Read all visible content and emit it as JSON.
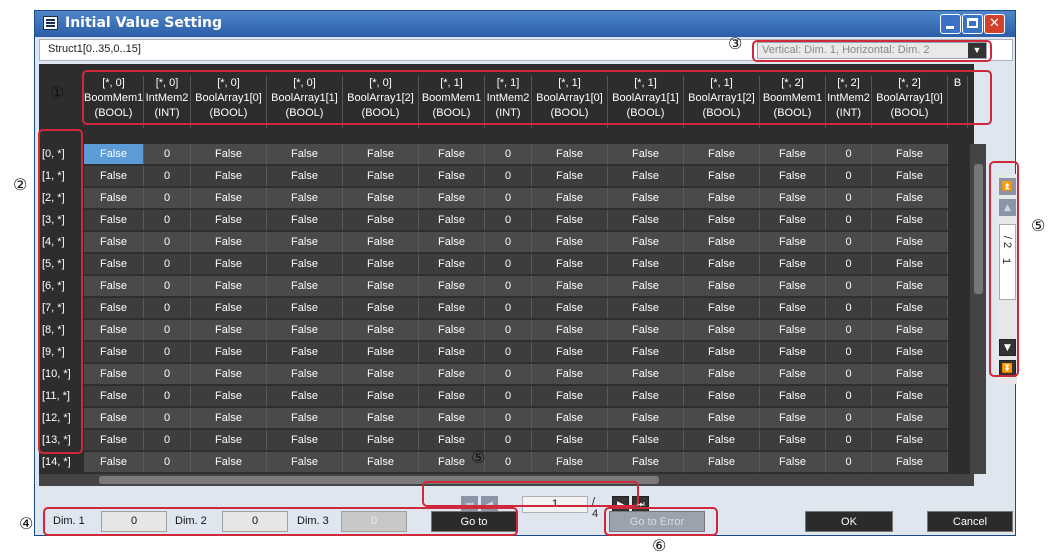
{
  "window": {
    "title": "Initial Value Setting",
    "minimize_icon": "minimize-icon",
    "maximize_icon": "maximize-icon",
    "close_icon": "close-icon",
    "close_glyph": "✕"
  },
  "path": "Struct1[0..35,0..15]",
  "dim_selector": {
    "value": "Vertical: Dim. 1, Horizontal: Dim. 2",
    "arrow": "▼"
  },
  "columns": [
    {
      "line1": "[*, 0]",
      "line2": "BoomMem1",
      "line3": "(BOOL)"
    },
    {
      "line1": "[*, 0]",
      "line2": "IntMem2",
      "line3": "(INT)"
    },
    {
      "line1": "[*, 0]",
      "line2": "BoolArray1[0]",
      "line3": "(BOOL)"
    },
    {
      "line1": "[*, 0]",
      "line2": "BoolArray1[1]",
      "line3": "(BOOL)"
    },
    {
      "line1": "[*, 0]",
      "line2": "BoolArray1[2]",
      "line3": "(BOOL)"
    },
    {
      "line1": "[*, 1]",
      "line2": "BoomMem1",
      "line3": "(BOOL)"
    },
    {
      "line1": "[*, 1]",
      "line2": "IntMem2",
      "line3": "(INT)"
    },
    {
      "line1": "[*, 1]",
      "line2": "BoolArray1[0]",
      "line3": "(BOOL)"
    },
    {
      "line1": "[*, 1]",
      "line2": "BoolArray1[1]",
      "line3": "(BOOL)"
    },
    {
      "line1": "[*, 1]",
      "line2": "BoolArray1[2]",
      "line3": "(BOOL)"
    },
    {
      "line1": "[*, 2]",
      "line2": "BoomMem1",
      "line3": "(BOOL)"
    },
    {
      "line1": "[*, 2]",
      "line2": "IntMem2",
      "line3": "(INT)"
    },
    {
      "line1": "[*, 2]",
      "line2": "BoolArray1[0]",
      "line3": "(BOOL)"
    },
    {
      "line1": "",
      "line2": "B",
      "line3": ""
    }
  ],
  "rows": [
    {
      "label": "[0, *]",
      "values": [
        "False",
        "0",
        "False",
        "False",
        "False",
        "False",
        "0",
        "False",
        "False",
        "False",
        "False",
        "0",
        "False"
      ]
    },
    {
      "label": "[1, *]",
      "values": [
        "False",
        "0",
        "False",
        "False",
        "False",
        "False",
        "0",
        "False",
        "False",
        "False",
        "False",
        "0",
        "False"
      ]
    },
    {
      "label": "[2, *]",
      "values": [
        "False",
        "0",
        "False",
        "False",
        "False",
        "False",
        "0",
        "False",
        "False",
        "False",
        "False",
        "0",
        "False"
      ]
    },
    {
      "label": "[3, *]",
      "values": [
        "False",
        "0",
        "False",
        "False",
        "False",
        "False",
        "0",
        "False",
        "False",
        "False",
        "False",
        "0",
        "False"
      ]
    },
    {
      "label": "[4, *]",
      "values": [
        "False",
        "0",
        "False",
        "False",
        "False",
        "False",
        "0",
        "False",
        "False",
        "False",
        "False",
        "0",
        "False"
      ]
    },
    {
      "label": "[5, *]",
      "values": [
        "False",
        "0",
        "False",
        "False",
        "False",
        "False",
        "0",
        "False",
        "False",
        "False",
        "False",
        "0",
        "False"
      ]
    },
    {
      "label": "[6, *]",
      "values": [
        "False",
        "0",
        "False",
        "False",
        "False",
        "False",
        "0",
        "False",
        "False",
        "False",
        "False",
        "0",
        "False"
      ]
    },
    {
      "label": "[7, *]",
      "values": [
        "False",
        "0",
        "False",
        "False",
        "False",
        "False",
        "0",
        "False",
        "False",
        "False",
        "False",
        "0",
        "False"
      ]
    },
    {
      "label": "[8, *]",
      "values": [
        "False",
        "0",
        "False",
        "False",
        "False",
        "False",
        "0",
        "False",
        "False",
        "False",
        "False",
        "0",
        "False"
      ]
    },
    {
      "label": "[9, *]",
      "values": [
        "False",
        "0",
        "False",
        "False",
        "False",
        "False",
        "0",
        "False",
        "False",
        "False",
        "False",
        "0",
        "False"
      ]
    },
    {
      "label": "[10, *]",
      "values": [
        "False",
        "0",
        "False",
        "False",
        "False",
        "False",
        "0",
        "False",
        "False",
        "False",
        "False",
        "0",
        "False"
      ]
    },
    {
      "label": "[11, *]",
      "values": [
        "False",
        "0",
        "False",
        "False",
        "False",
        "False",
        "0",
        "False",
        "False",
        "False",
        "False",
        "0",
        "False"
      ]
    },
    {
      "label": "[12, *]",
      "values": [
        "False",
        "0",
        "False",
        "False",
        "False",
        "False",
        "0",
        "False",
        "False",
        "False",
        "False",
        "0",
        "False"
      ]
    },
    {
      "label": "[13, *]",
      "values": [
        "False",
        "0",
        "False",
        "False",
        "False",
        "False",
        "0",
        "False",
        "False",
        "False",
        "False",
        "0",
        "False"
      ]
    },
    {
      "label": "[14, *]",
      "values": [
        "False",
        "0",
        "False",
        "False",
        "False",
        "False",
        "0",
        "False",
        "False",
        "False",
        "False",
        "0",
        "False"
      ]
    }
  ],
  "vertical_pager": {
    "page": "1",
    "of": "/ 2",
    "first_icon": "first-page-icon",
    "prev_icon": "previous-page-icon",
    "next_icon": "next-page-icon",
    "last_icon": "last-page-icon"
  },
  "horizontal_pager": {
    "page": "1",
    "of": "/ 4",
    "first_glyph": "⏮",
    "prev_glyph": "◀",
    "next_glyph": "▶",
    "last_glyph": "⏭"
  },
  "footer": {
    "dim1_label": "Dim. 1",
    "dim1_value": "0",
    "dim2_label": "Dim. 2",
    "dim2_value": "0",
    "dim3_label": "Dim. 3",
    "dim3_value": "0",
    "goto_label": "Go to",
    "goto_error_label": "Go to Error",
    "ok_label": "OK",
    "cancel_label": "Cancel"
  },
  "callouts": [
    "①",
    "②",
    "③",
    "④",
    "⑤",
    "⑥"
  ],
  "colors": {
    "selected_cell": "#5b9bd8",
    "highlight": "#d0283b",
    "titlebar": "#2a5ea8"
  }
}
